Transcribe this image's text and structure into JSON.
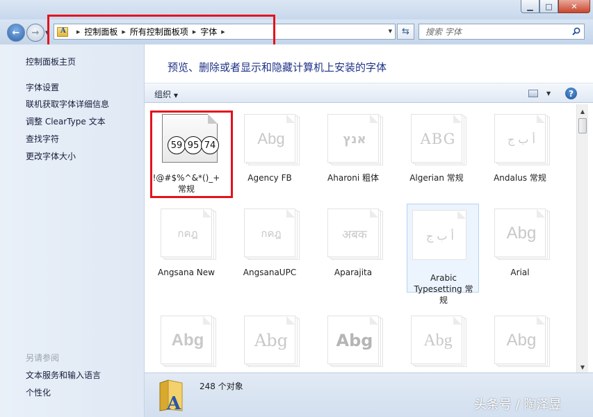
{
  "window": {
    "controls": [
      "minimize",
      "maximize",
      "close"
    ]
  },
  "nav": {
    "breadcrumb": [
      "控制面板",
      "所有控制面板项",
      "字体"
    ],
    "search_placeholder": "搜索 字体"
  },
  "sidebar": {
    "home": "控制面板主页",
    "links": [
      "字体设置",
      "联机获取字体详细信息",
      "调整 ClearType 文本",
      "查找字符",
      "更改字体大小"
    ],
    "see_also_title": "另请参阅",
    "see_also": [
      "文本服务和输入语言",
      "个性化"
    ]
  },
  "main": {
    "heading": "预览、删除或者显示和隐藏计算机上安装的字体",
    "organize": "组织",
    "fonts": [
      {
        "name": "!@#$%^&*()_+ 常规",
        "sample": "",
        "circles": [
          "59",
          "95",
          "74"
        ]
      },
      {
        "name": "Agency FB",
        "sample": "Abg"
      },
      {
        "name": "Aharoni 粗体",
        "sample": "אנץ"
      },
      {
        "name": "Algerian 常规",
        "sample": "ABG"
      },
      {
        "name": "Andalus 常规",
        "sample": "أ ب ج"
      },
      {
        "name": "Angsana New",
        "sample": "กคฎ"
      },
      {
        "name": "AngsanaUPC",
        "sample": "กคฎ"
      },
      {
        "name": "Aparajita",
        "sample": "अबक"
      },
      {
        "name": "Arabic Typesetting 常规",
        "sample": "أ ب ج"
      },
      {
        "name": "Arial",
        "sample": "Abg"
      },
      {
        "name": "",
        "sample": "Abg"
      },
      {
        "name": "",
        "sample": "Abg"
      },
      {
        "name": "",
        "sample": "Abg"
      },
      {
        "name": "",
        "sample": "Abg"
      },
      {
        "name": "",
        "sample": "Abg"
      }
    ]
  },
  "status": {
    "count_text": "248 个对象"
  },
  "watermark": "头条号 / 陶泽昱",
  "colors": {
    "highlight_box": "#e4121b",
    "heading": "#1e3287",
    "selected_tile": "#ecf4fd"
  }
}
